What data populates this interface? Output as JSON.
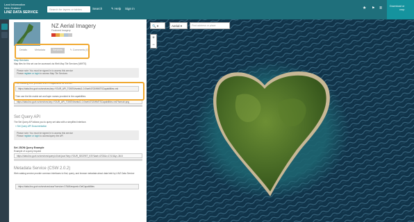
{
  "header": {
    "org_line1": "Land Information",
    "org_line2": "New Zealand",
    "service_name": "LINZ DATA SERVICE",
    "search_placeholder": "Search for layers or tables",
    "search_label": "Search",
    "help_label": "Help",
    "signin_label": "Sign in",
    "download_line1": "Download or",
    "download_line2": "crop"
  },
  "layer": {
    "title": "NZ Aerial Imagery",
    "subtitle": "Featured Imagery",
    "legend_colors": [
      "#d6392a",
      "#e6a23c",
      "#f2e08a",
      "#b0c4d4",
      "#c8c8c8"
    ]
  },
  "tabs": [
    {
      "label": "Details"
    },
    {
      "label": "Metadata"
    },
    {
      "label": "Services"
    },
    {
      "label": "Comments (0)"
    }
  ],
  "services": {
    "section_title": "Map Services",
    "wmts_intro": "Map tiles for this set can be accessed via Web Map Tile Services (WMTS)",
    "notice_line1": "Please note: You must be signed in to access this service",
    "notice_prefix": "Please ",
    "notice_link": "register or login",
    "notice_suffix": " to access Map Tile Services",
    "notice2_line1": "The following URL provides WMTS capabilities for this set",
    "wmts_url": "https://data.linz.govt.nz/services;key=YOUR_API_TOKEN/wmts/1.0.0/set/4702/WMTSCapabilities.xml",
    "notice2_line2": "Then use the tile matrix set and layer names provided in the capabilities",
    "long_url": "https://data.linz.govt.nz/services;key=YOUR_API_TOKEN/wmts/1.0.0/set/4702/WMTSCapabilities.xml?format=png",
    "query_title": "Set Query API",
    "query_intro": "The Set Query API allows you to query set data with a simplified interface.",
    "query_doc_link": "Set Query API Documentation",
    "query_notice1": "Please note: You must be signed in to access this service",
    "query_notice_link": "register or login",
    "query_notice_suffix": " to access/query the API",
    "json_title": "Set JSON Query Example",
    "json_sub": "Example of a query request",
    "query_url": "https://data.linz.govt.nz/services/query/v1/set.json?key=YOUR_SECRET_KEY&set=4702&x=174.5&y=-36.8",
    "metadata_title": "Metadata Service (CSW 2.0.2)",
    "metadata_text": "Web catalog service provide common interfaces to find, query, and browse metadata about data held by LINZ Data Service",
    "csw_url": "https://data.linz.govt.nz/services/csw/?service=CSW&request=GetCapabilities"
  },
  "map": {
    "search_placeholder": "Find address or place",
    "basemap_label": "Aerial",
    "zoom_in": "+",
    "zoom_out": "−"
  }
}
